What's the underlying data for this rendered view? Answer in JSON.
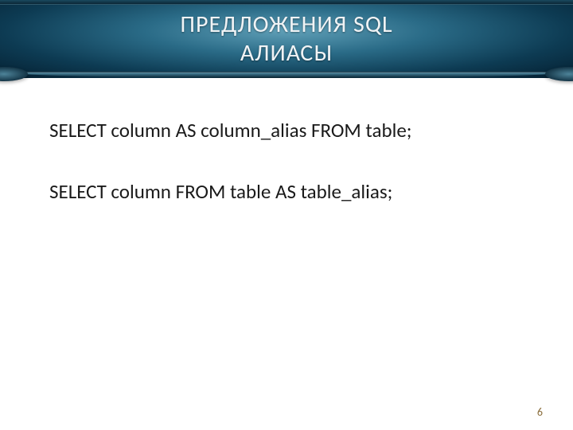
{
  "header": {
    "title_line1": "ПРЕДЛОЖЕНИЯ SQL",
    "title_line2": "АЛИАСЫ"
  },
  "content": {
    "sql1": "SELECT column AS column_alias FROM table;",
    "sql2": "SELECT column FROM table AS table_alias;"
  },
  "page_number": "6"
}
